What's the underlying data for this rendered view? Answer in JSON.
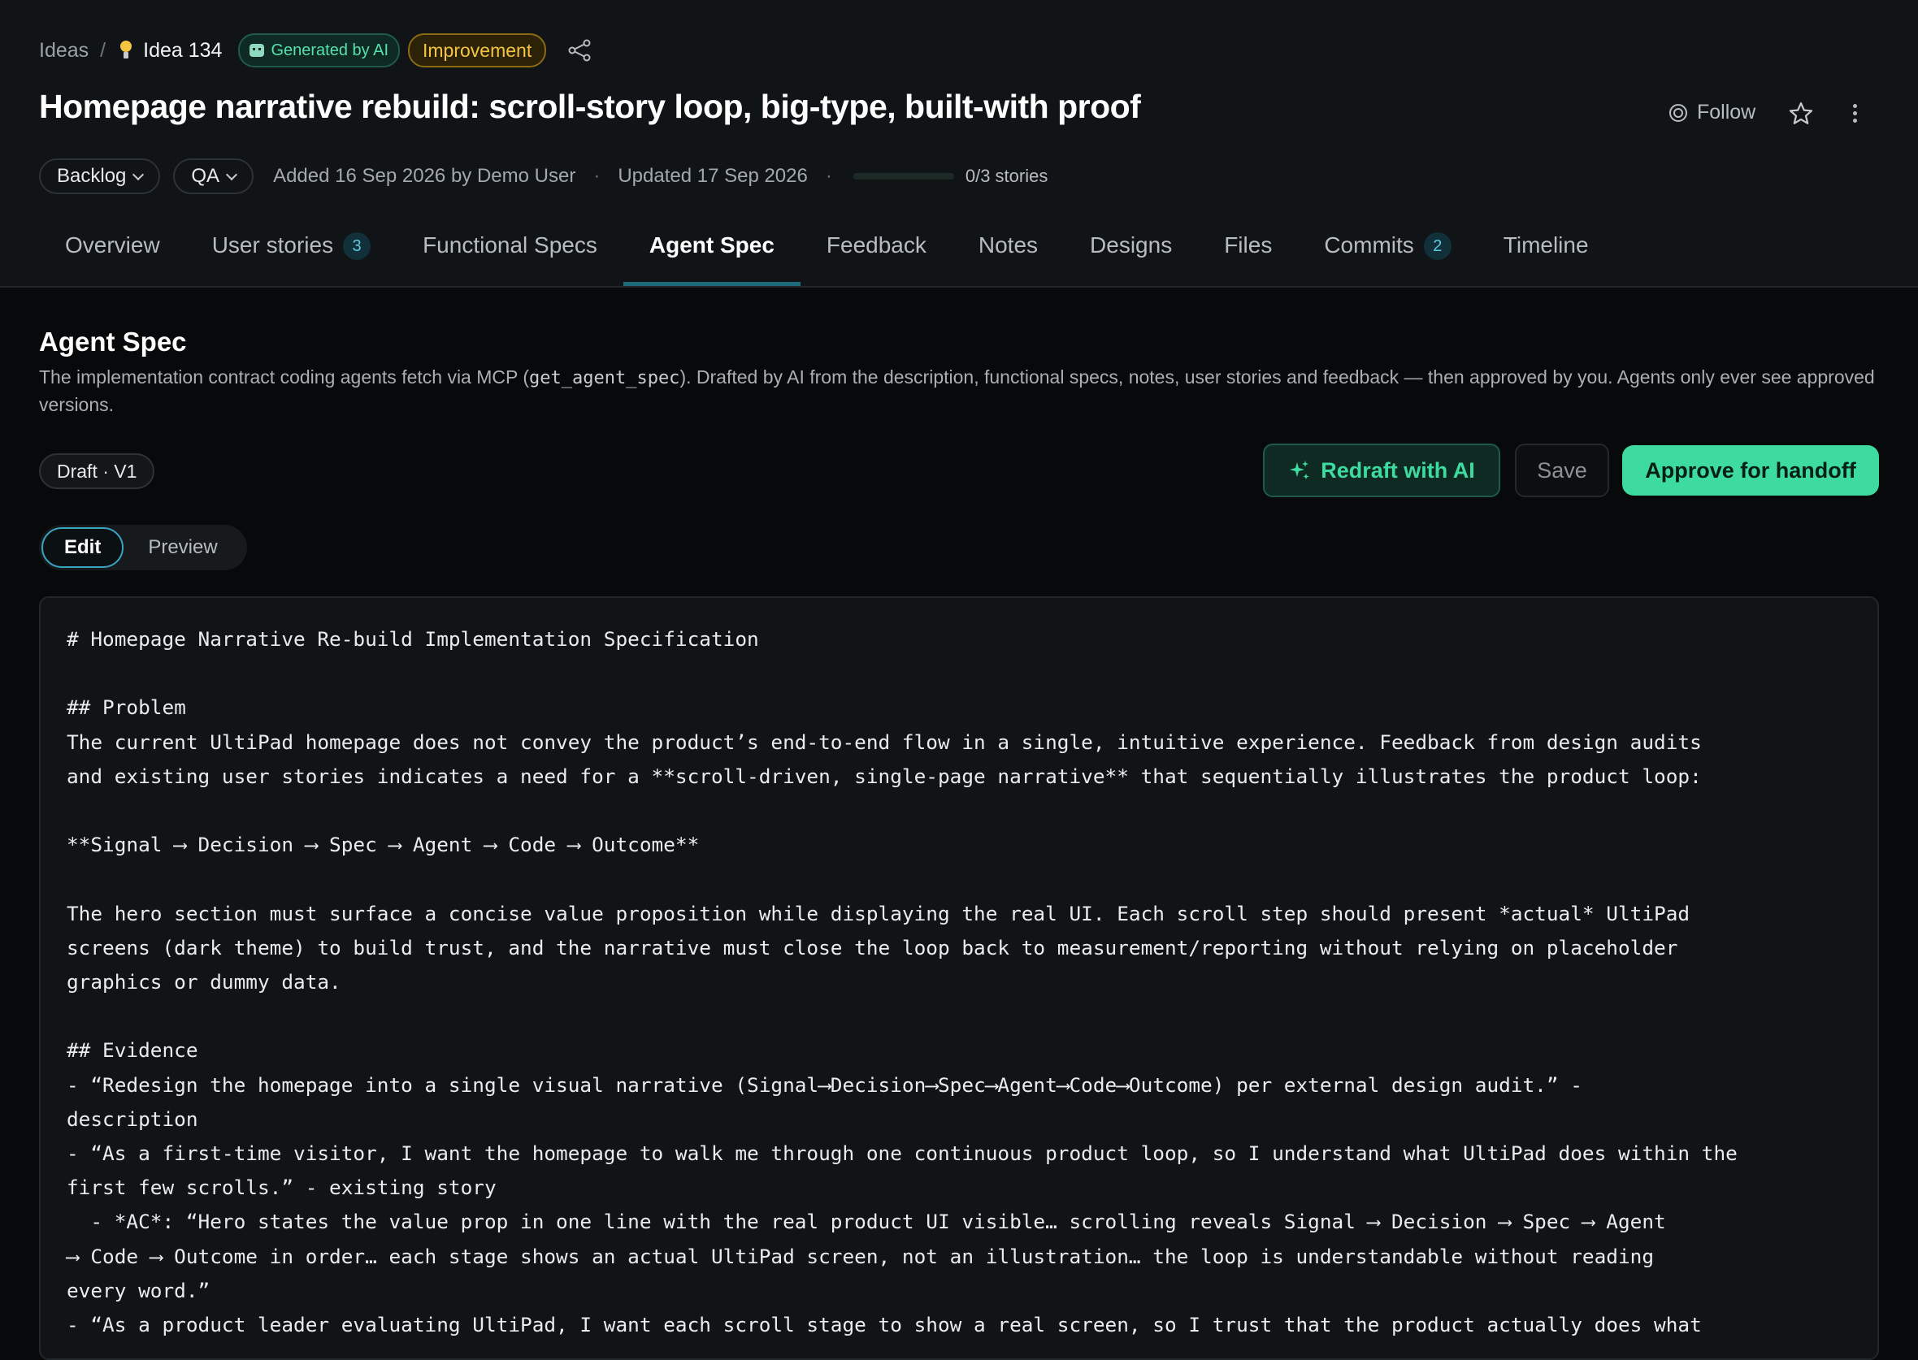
{
  "breadcrumb": {
    "root": "Ideas",
    "separator": "/",
    "current": "Idea 134"
  },
  "badges": {
    "ai": "Generated by AI",
    "type": "Improvement"
  },
  "title": "Homepage narrative rebuild: scroll-story loop, big-type, built-with proof",
  "actions": {
    "follow": "Follow"
  },
  "meta": {
    "status": "Backlog",
    "stage": "QA",
    "added": "Added 16 Sep 2026 by Demo User",
    "dot": "·",
    "updated": "Updated 17 Sep 2026",
    "progress_value": 0,
    "stories": "0/3 stories"
  },
  "tabs": [
    {
      "label": "Overview"
    },
    {
      "label": "User stories",
      "count": "3"
    },
    {
      "label": "Functional Specs"
    },
    {
      "label": "Agent Spec",
      "active": true
    },
    {
      "label": "Feedback"
    },
    {
      "label": "Notes"
    },
    {
      "label": "Designs"
    },
    {
      "label": "Files"
    },
    {
      "label": "Commits",
      "count": "2"
    },
    {
      "label": "Timeline"
    }
  ],
  "section": {
    "heading": "Agent Spec",
    "desc_before": "The implementation contract coding agents fetch via MCP (",
    "desc_code": "get_agent_spec",
    "desc_after": "). Drafted by AI from the description, functional specs, notes, user stories and feedback — then approved by you. Agents only ever see approved versions.",
    "version": "Draft · V1",
    "redraft": "Redraft with AI",
    "save": "Save",
    "approve": "Approve for handoff",
    "mode_edit": "Edit",
    "mode_preview": "Preview"
  },
  "editor": {
    "content": "# Homepage Narrative Re-build Implementation Specification\n\n## Problem\nThe current UltiPad homepage does not convey the product’s end-to-end flow in a single, intuitive experience. Feedback from design audits\nand existing user stories indicates a need for a **scroll-driven, single-page narrative** that sequentially illustrates the product loop:\n\n**Signal ⟶ Decision ⟶ Spec ⟶ Agent ⟶ Code ⟶ Outcome**\n\nThe hero section must surface a concise value proposition while displaying the real UI. Each scroll step should present *actual* UltiPad\nscreens (dark theme) to build trust, and the narrative must close the loop back to measurement/reporting without relying on placeholder\ngraphics or dummy data.\n\n## Evidence\n- “Redesign the homepage into a single visual narrative (Signal⟶Decision⟶Spec⟶Agent⟶Code⟶Outcome) per external design audit.” -\ndescription\n- “As a first-time visitor, I want the homepage to walk me through one continuous product loop, so I understand what UltiPad does within the\nfirst few scrolls.” - existing story\n  - *AC*: “Hero states the value prop in one line with the real product UI visible… scrolling reveals Signal ⟶ Decision ⟶ Spec ⟶ Agent\n⟶ Code ⟶ Outcome in order… each stage shows an actual UltiPad screen, not an illustration… the loop is understandable without reading\nevery word.”\n- “As a product leader evaluating UltiPad, I want each scroll stage to show a real screen, so I trust that the product actually does what"
  }
}
